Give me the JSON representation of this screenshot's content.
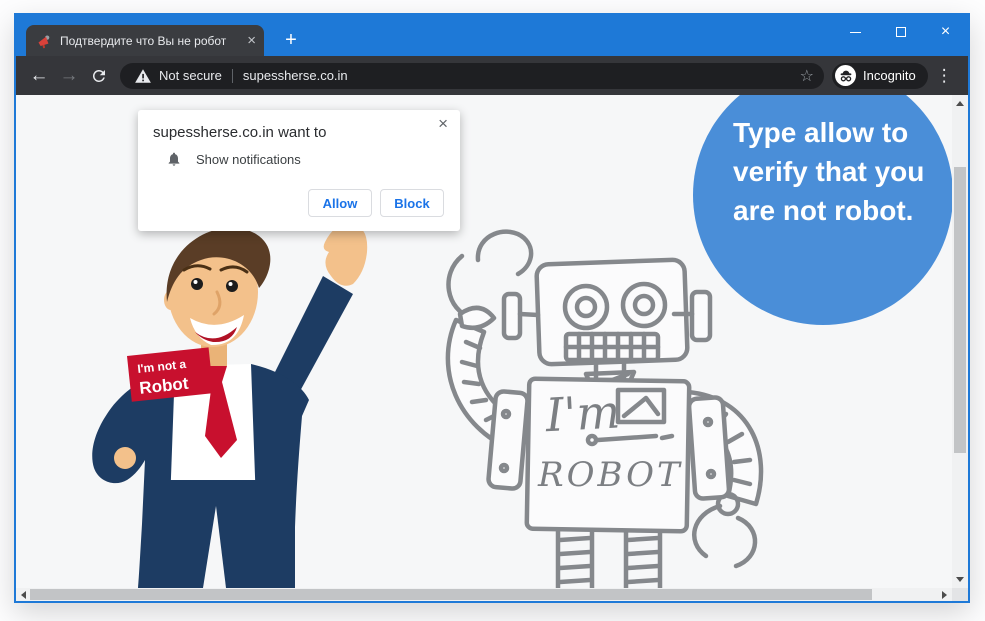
{
  "window_controls": {
    "close_glyph": "×"
  },
  "tabbar": {
    "tab_title": "Подтвердите что Вы не робот",
    "tab_close_glyph": "×",
    "new_tab_glyph": "+"
  },
  "toolbar": {
    "back_glyph": "←",
    "forward_glyph": "→",
    "security_label": "Not secure",
    "url": "supessherse.co.in",
    "star_glyph": "☆",
    "incognito_label": "Incognito",
    "menu_glyph": "⋮"
  },
  "dialog": {
    "title": "supessherse.co.in want to",
    "permission": "Show notifications",
    "allow_label": "Allow",
    "block_label": "Block",
    "close_glyph": "×"
  },
  "page": {
    "bubble": {
      "line1": "Type allow to",
      "line2": "verify that you",
      "line3": "are not robot."
    },
    "badge": {
      "line1": "I'm not a",
      "line2": "Robot"
    },
    "robot_text": {
      "line1": "I'm",
      "line2": "ROBOT"
    }
  },
  "colors": {
    "titlebar_blue": "#1e79d7",
    "bubble_blue": "#4a8ed8",
    "toolbar_dark": "#35363a",
    "urlbar_dark": "#1e1f22",
    "badge_red": "#c8102e",
    "suit_navy": "#1d3c63",
    "button_blue": "#1a73e8",
    "sketch_gray": "#85888c"
  }
}
